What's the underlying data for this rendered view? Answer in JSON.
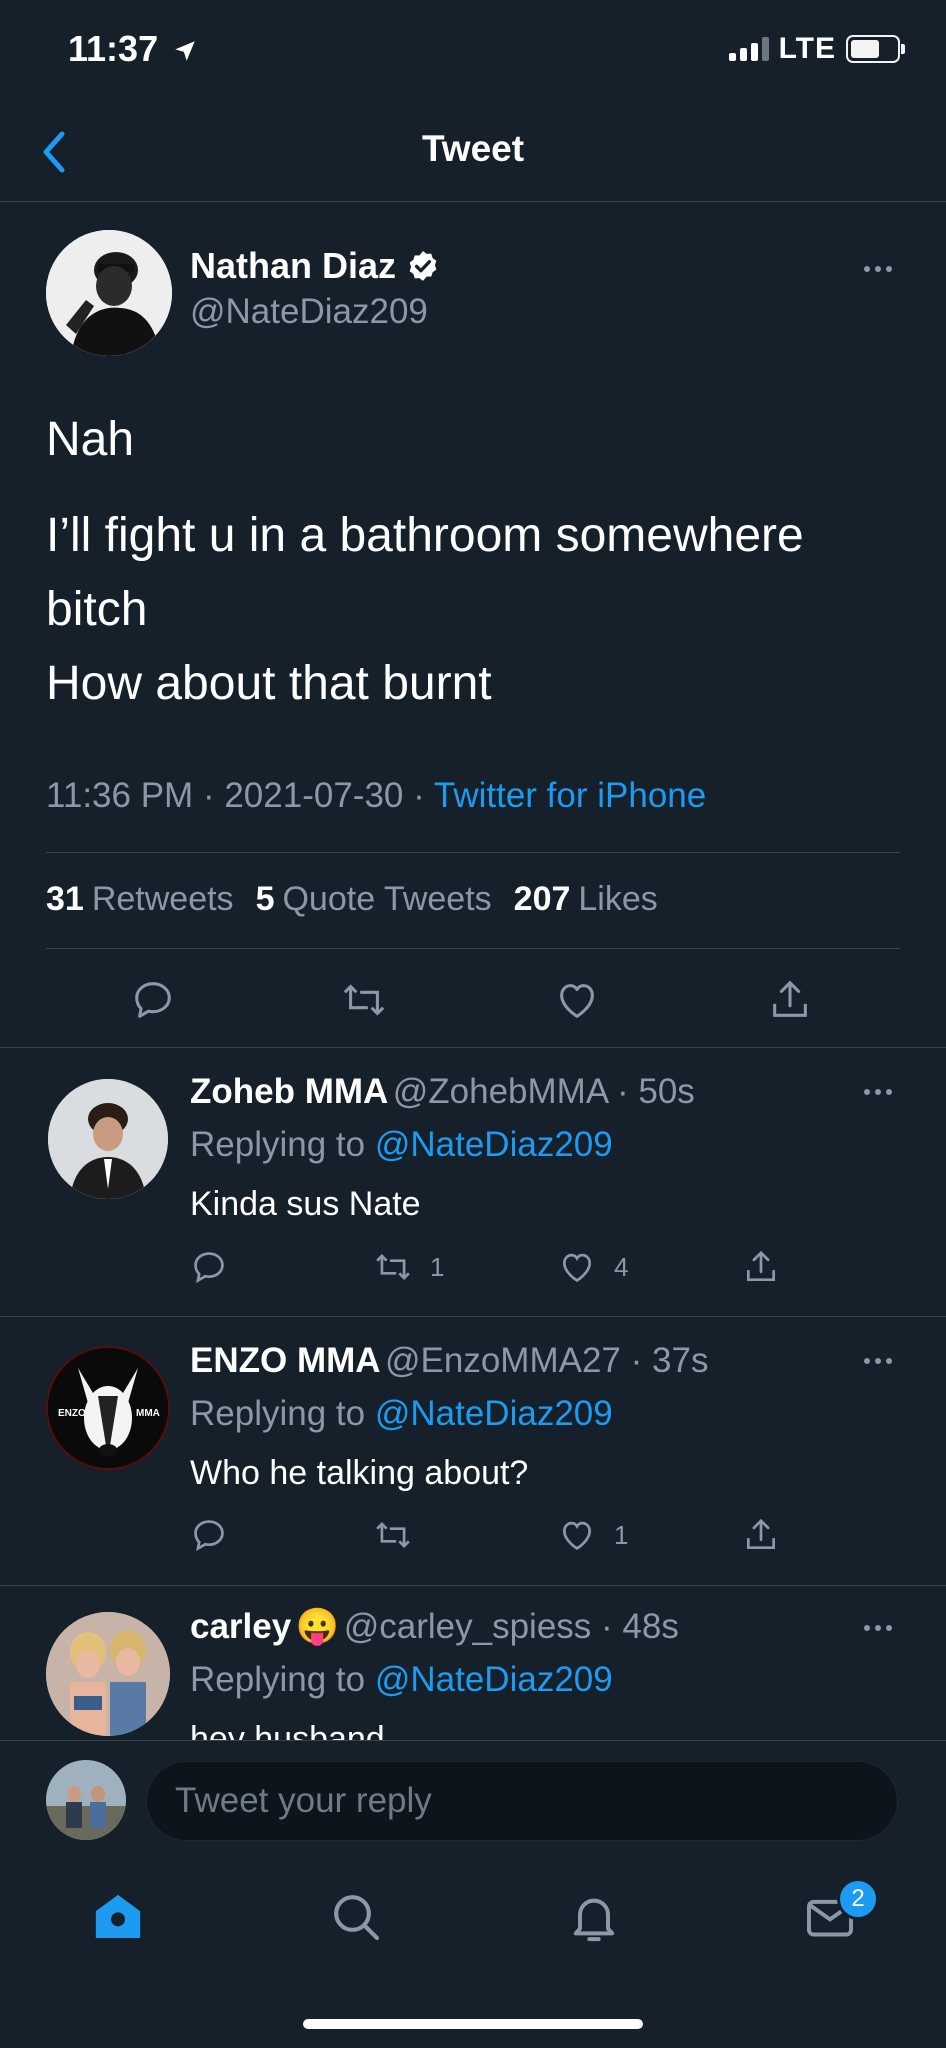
{
  "status_bar": {
    "time": "11:37",
    "network": "LTE"
  },
  "header": {
    "title": "Tweet"
  },
  "main_tweet": {
    "name": "Nathan Diaz",
    "handle": "@NateDiaz209",
    "lines": [
      "Nah",
      "I’ll fight u in a bathroom somewhere",
      "bitch",
      "How about that burnt"
    ],
    "time": "11:36 PM",
    "date": "2021-07-30",
    "source": "Twitter for iPhone",
    "stats": {
      "retweets_count": "31",
      "retweets_label": "Retweets",
      "quotes_count": "5",
      "quotes_label": "Quote Tweets",
      "likes_count": "207",
      "likes_label": "Likes"
    }
  },
  "replies": [
    {
      "name": "Zoheb MMA",
      "handle": "@ZohebMMA",
      "time": "50s",
      "replying_label": "Replying to",
      "replying_to": "@NateDiaz209",
      "text": "Kinda sus Nate",
      "retweets": "1",
      "likes": "4"
    },
    {
      "name": "ENZO MMA",
      "handle": "@EnzoMMA27",
      "time": "37s",
      "replying_label": "Replying to",
      "replying_to": "@NateDiaz209",
      "text": "Who he talking about?",
      "retweets": "",
      "likes": "1",
      "avatar_left": "ENZO",
      "avatar_right": "MMA"
    },
    {
      "name": "carley",
      "emoji": "😛",
      "handle": "@carley_spiess",
      "time": "48s",
      "replying_label": "Replying to",
      "replying_to": "@NateDiaz209",
      "text": "hey husband"
    }
  ],
  "reply_bar": {
    "placeholder": "Tweet your reply"
  },
  "tab_bar": {
    "messages_badge": "2"
  },
  "colors": {
    "background": "#15202b",
    "accent": "#1d9bf0",
    "muted": "#8b98a5",
    "divider": "#38444d"
  }
}
